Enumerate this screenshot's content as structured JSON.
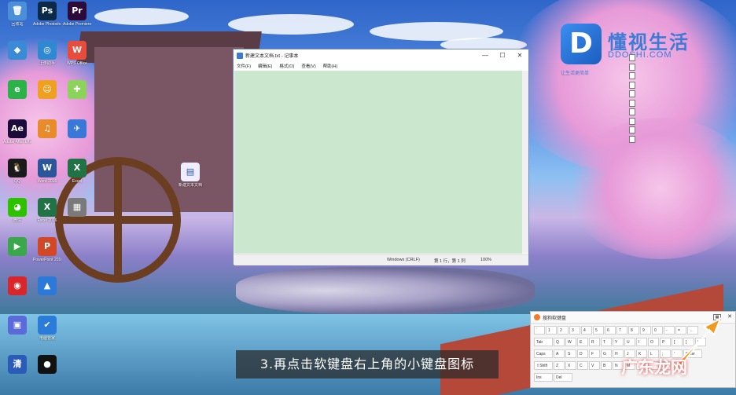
{
  "desktop_icons": [
    {
      "name": "recycle-bin-icon",
      "label": "回收站",
      "glyph": "🗑",
      "color": "#4a8fd8",
      "col": 0,
      "row": 0
    },
    {
      "name": "photoshop-icon",
      "label": "Adobe Photoshop 2020",
      "glyph": "Ps",
      "color": "#0b2a4a",
      "col": 1,
      "row": 0
    },
    {
      "name": "premiere-icon",
      "label": "Adobe Premiere",
      "glyph": "Pr",
      "color": "#2a0b3a",
      "col": 2,
      "row": 0
    },
    {
      "name": "app-icon-1",
      "label": "",
      "glyph": "◆",
      "color": "#3a8ad6",
      "col": 0,
      "row": 1
    },
    {
      "name": "app-icon-2",
      "label": "上传助手",
      "glyph": "◎",
      "color": "#2e89d0",
      "col": 1,
      "row": 1
    },
    {
      "name": "wps-icon",
      "label": "WPS Office",
      "glyph": "W",
      "color": "#e84c3d",
      "col": 2,
      "row": 1
    },
    {
      "name": "browser-icon",
      "label": "",
      "glyph": "e",
      "color": "#2bb34a",
      "col": 0,
      "row": 2
    },
    {
      "name": "app-icon-3",
      "label": "",
      "glyph": "☺",
      "color": "#f0a020",
      "col": 1,
      "row": 2
    },
    {
      "name": "app-icon-4",
      "label": "",
      "glyph": "✚",
      "color": "#8bd35a",
      "col": 2,
      "row": 2
    },
    {
      "name": "aftereffects-icon",
      "label": "Adobe After Effects",
      "glyph": "Ae",
      "color": "#1c0b3a",
      "col": 0,
      "row": 3
    },
    {
      "name": "app-icon-5",
      "label": "",
      "glyph": "♫",
      "color": "#e88b2a",
      "col": 1,
      "row": 3
    },
    {
      "name": "app-icon-6",
      "label": "",
      "glyph": "✈",
      "color": "#3a78d8",
      "col": 2,
      "row": 3
    },
    {
      "name": "qq-icon",
      "label": "QQ",
      "glyph": "🐧",
      "color": "#1a1a1a",
      "col": 0,
      "row": 4
    },
    {
      "name": "word-icon",
      "label": "Word 2016",
      "glyph": "W",
      "color": "#2b579a",
      "col": 1,
      "row": 4
    },
    {
      "name": "excel-icon",
      "label": "Excel",
      "glyph": "X",
      "color": "#217346",
      "col": 2,
      "row": 4
    },
    {
      "name": "wechat-icon",
      "label": "微信",
      "glyph": "◕",
      "color": "#2dc100",
      "col": 0,
      "row": 5
    },
    {
      "name": "excel2016-icon",
      "label": "Excel 2016",
      "glyph": "X",
      "color": "#217346",
      "col": 1,
      "row": 5
    },
    {
      "name": "app-icon-7",
      "label": "",
      "glyph": "▦",
      "color": "#7a7a7a",
      "col": 2,
      "row": 5
    },
    {
      "name": "media-icon",
      "label": "",
      "glyph": "▶",
      "color": "#3aa84a",
      "col": 0,
      "row": 6
    },
    {
      "name": "powerpoint-icon",
      "label": "PowerPoint 2016",
      "glyph": "P",
      "color": "#d24726",
      "col": 1,
      "row": 6
    },
    {
      "name": "netease-icon",
      "label": "",
      "glyph": "◉",
      "color": "#d8262a",
      "col": 0,
      "row": 7
    },
    {
      "name": "app-icon-8",
      "label": "",
      "glyph": "▲",
      "color": "#2b79d8",
      "col": 1,
      "row": 7
    },
    {
      "name": "app-icon-9",
      "label": "",
      "glyph": "▣",
      "color": "#5a6ad8",
      "col": 0,
      "row": 8
    },
    {
      "name": "security-icon",
      "label": "电脑管家",
      "glyph": "✔",
      "color": "#2b7bd8",
      "col": 1,
      "row": 8
    },
    {
      "name": "app-icon-10",
      "label": "",
      "glyph": "清",
      "color": "#2a5bb8",
      "col": 0,
      "row": 9
    },
    {
      "name": "recorder-icon",
      "label": "",
      "glyph": "●",
      "color": "#111111",
      "col": 1,
      "row": 9
    }
  ],
  "desktop_file": {
    "label": "新建文本文档"
  },
  "notepad": {
    "title": "新建文本文档.txt - 记事本",
    "controls": [
      "—",
      "☐",
      "✕"
    ],
    "menu": [
      "文件(F)",
      "编辑(E)",
      "格式(O)",
      "查看(V)",
      "帮助(H)"
    ],
    "status": {
      "encoding_line": "Windows (CRLF)",
      "position": "第 1 行，第 1 列",
      "zoom": "100%"
    }
  },
  "watermark": {
    "logo_letter": "D",
    "title": "懂视生活",
    "url": "DDOSHI.COM",
    "slogan": "让生活更简单"
  },
  "right_files": [
    "",
    "",
    "",
    "",
    "",
    "",
    "",
    "",
    "",
    ""
  ],
  "soft_keyboard": {
    "title": "搜狗软键盘",
    "rows": [
      [
        "`",
        "1",
        "2",
        "3",
        "4",
        "5",
        "6",
        "7",
        "8",
        "9",
        "0",
        "-",
        "=",
        "←"
      ],
      [
        "Tab",
        "Q",
        "W",
        "E",
        "R",
        "T",
        "Y",
        "U",
        "I",
        "O",
        "P",
        "[",
        "]",
        "\\"
      ],
      [
        "Caps",
        "A",
        "S",
        "D",
        "F",
        "G",
        "H",
        "J",
        "K",
        "L",
        ";",
        "'",
        "Enter"
      ],
      [
        "⇧Shift",
        "Z",
        "X",
        "C",
        "V",
        "B",
        "N",
        "M",
        ",",
        ".",
        "/"
      ],
      [
        "Ins",
        "Del"
      ]
    ],
    "close_glyph": "✕"
  },
  "subtitle": "3.再点击软键盘右上角的小键盘图标",
  "corner_logo": "广东龙网"
}
